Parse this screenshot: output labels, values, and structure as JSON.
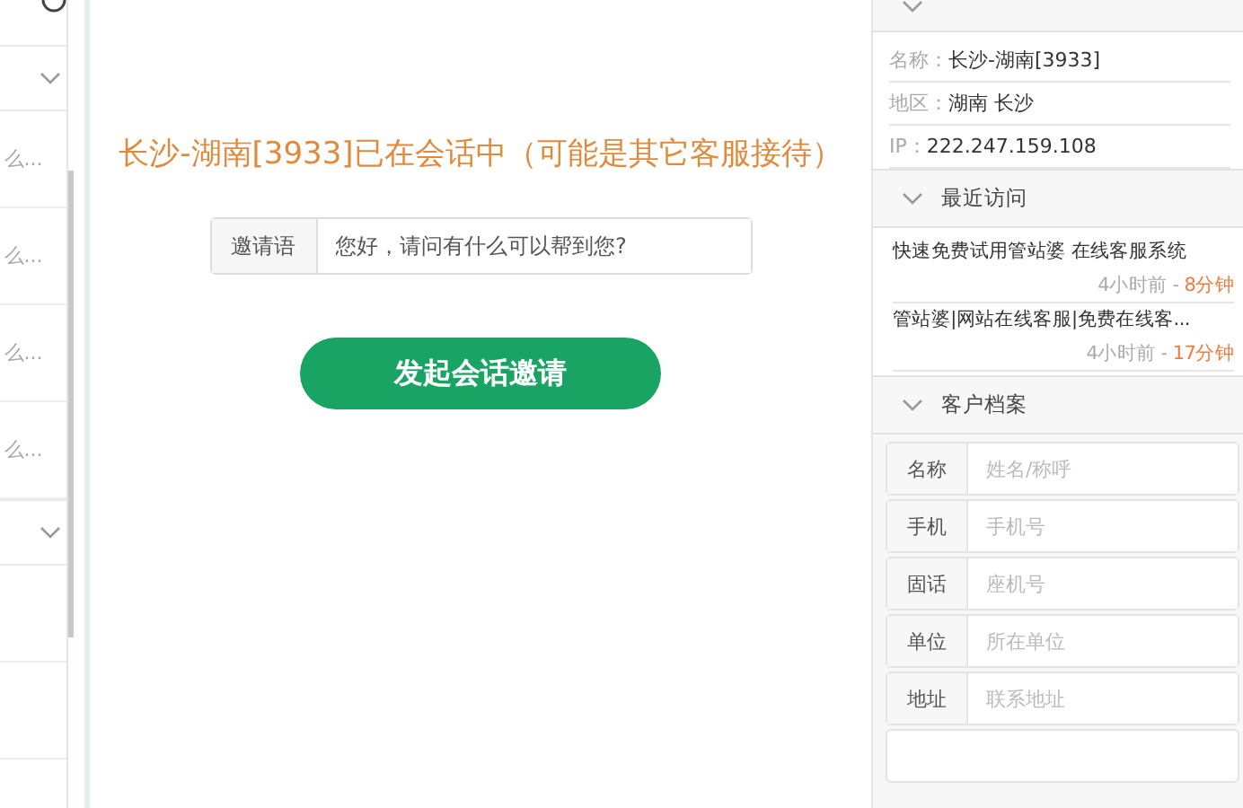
{
  "left_list": {
    "groups": [
      {
        "expanded": true,
        "items": [
          {
            "preview": "么..."
          },
          {
            "preview": "么..."
          },
          {
            "preview": "么..."
          },
          {
            "preview": "么..."
          }
        ]
      },
      {
        "expanded": true
      }
    ]
  },
  "main": {
    "status": "长沙-湖南[3933]已在会话中（可能是其它客服接待）",
    "invite_label": "邀请语",
    "invite_value": "您好，请问有什么可以帮到您?",
    "invite_button": "发起会话邀请"
  },
  "right_panel": {
    "basic_info": {
      "expanded": true,
      "fields": [
        {
          "label": "名称：",
          "value": "长沙-湖南[3933]"
        },
        {
          "label": "地区：",
          "value": "湖南 长沙"
        },
        {
          "label": "IP：",
          "value": "222.247.159.108"
        }
      ]
    },
    "recent_visits": {
      "title": "最近访问",
      "expanded": true,
      "visits": [
        {
          "title": "快速免费试用管站婆 在线客服系统",
          "ago": "4小时前 - ",
          "duration": "8分钟"
        },
        {
          "title": "管站婆|网站在线客服|免费在线客...",
          "ago": "4小时前 - ",
          "duration": "17分钟"
        }
      ]
    },
    "customer_profile": {
      "title": "客户档案",
      "expanded": true,
      "fields": [
        {
          "label": "名称",
          "placeholder": "姓名/称呼"
        },
        {
          "label": "手机",
          "placeholder": "手机号"
        },
        {
          "label": "固话",
          "placeholder": "座机号"
        },
        {
          "label": "单位",
          "placeholder": "所在单位"
        },
        {
          "label": "地址",
          "placeholder": "联系地址"
        }
      ]
    }
  }
}
